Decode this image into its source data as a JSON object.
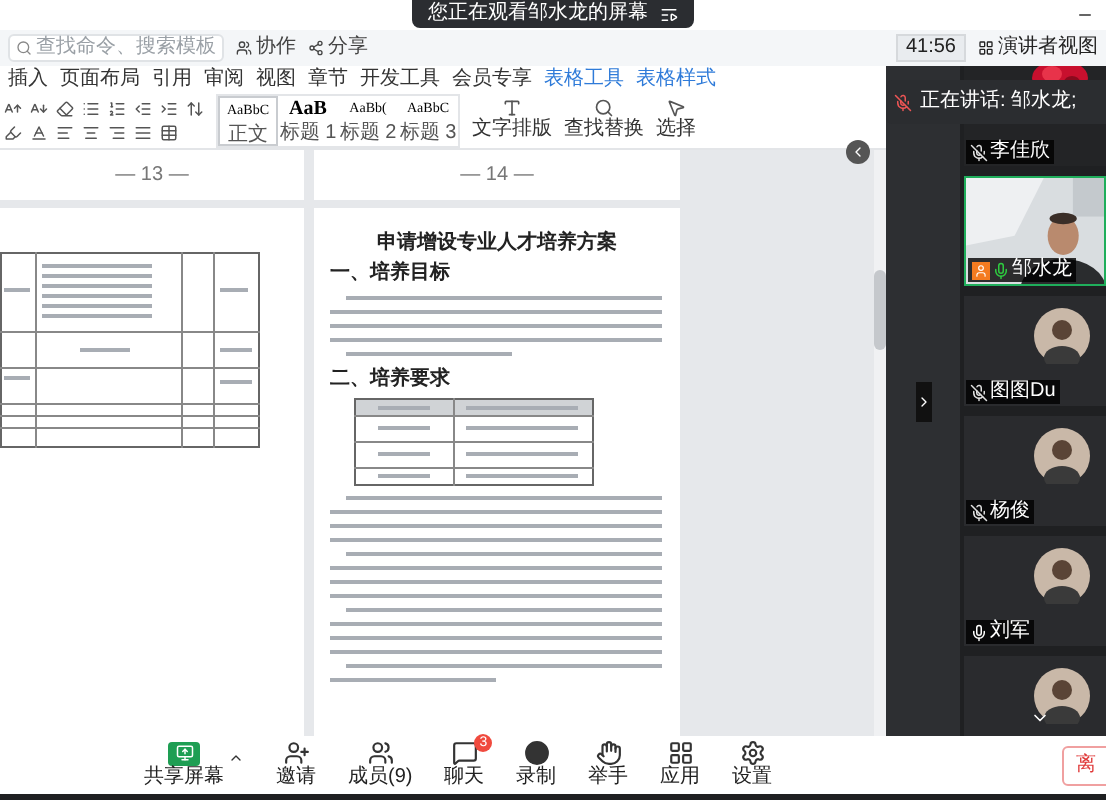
{
  "banner": {
    "text": "您正在观看邹水龙的屏幕"
  },
  "meeting_bar": {
    "timer": "41:56",
    "view_button": "演讲者视图"
  },
  "doc_app": {
    "menu": [
      {
        "label": "插入",
        "kind": "normal"
      },
      {
        "label": "页面布局",
        "kind": "normal"
      },
      {
        "label": "引用",
        "kind": "normal"
      },
      {
        "label": "审阅",
        "kind": "normal"
      },
      {
        "label": "视图",
        "kind": "normal"
      },
      {
        "label": "章节",
        "kind": "normal"
      },
      {
        "label": "开发工具",
        "kind": "normal"
      },
      {
        "label": "会员专享",
        "kind": "normal"
      },
      {
        "label": "表格工具",
        "kind": "contextual"
      },
      {
        "label": "表格样式",
        "kind": "contextual"
      }
    ],
    "search": {
      "placeholder": "查找命令、搜索模板"
    },
    "actions": [
      "协作",
      "分享"
    ],
    "styles": [
      {
        "sample": "AaBbC",
        "label": "正文",
        "selected": true
      },
      {
        "sample": "AaB",
        "label": "标题 1",
        "selected": false
      },
      {
        "sample": "AaBb(",
        "label": "标题 2",
        "selected": false
      },
      {
        "sample": "AaBbC",
        "label": "标题 3",
        "selected": false
      }
    ],
    "tools": [
      "文字排版",
      "查找替换",
      "选择"
    ]
  },
  "pages": [
    {
      "page_number": "— 13 —"
    },
    {
      "page_number": "— 14 —"
    }
  ],
  "document": {
    "title": "申请增设专业人才培养方案",
    "headings": [
      "一、培养目标",
      "二、培养要求"
    ]
  },
  "speaker_notice": "正在讲话: 邹水龙;",
  "participants": [
    {
      "name": "李佳欣",
      "kind": "video",
      "muted": true,
      "active": false
    },
    {
      "name": "邹水龙",
      "kind": "video",
      "muted": false,
      "active": true
    },
    {
      "name": "图图Du",
      "kind": "avatar",
      "muted": true,
      "active": false
    },
    {
      "name": "杨俊",
      "kind": "avatar",
      "muted": true,
      "active": false
    },
    {
      "name": "刘军",
      "kind": "avatar",
      "muted": false,
      "active": false
    },
    {
      "kind": "avatar",
      "active": false
    }
  ],
  "toolbar": [
    {
      "label": "共享屏幕",
      "kind": "share"
    },
    {
      "label": "邀请",
      "kind": "invite"
    },
    {
      "label": "成员(9)",
      "kind": "members"
    },
    {
      "label": "聊天",
      "kind": "chat",
      "badge": "3"
    },
    {
      "label": "录制",
      "kind": "record"
    },
    {
      "label": "举手",
      "kind": "hand"
    },
    {
      "label": "应用",
      "kind": "apps"
    },
    {
      "label": "设置",
      "kind": "settings"
    }
  ],
  "leave": "离"
}
